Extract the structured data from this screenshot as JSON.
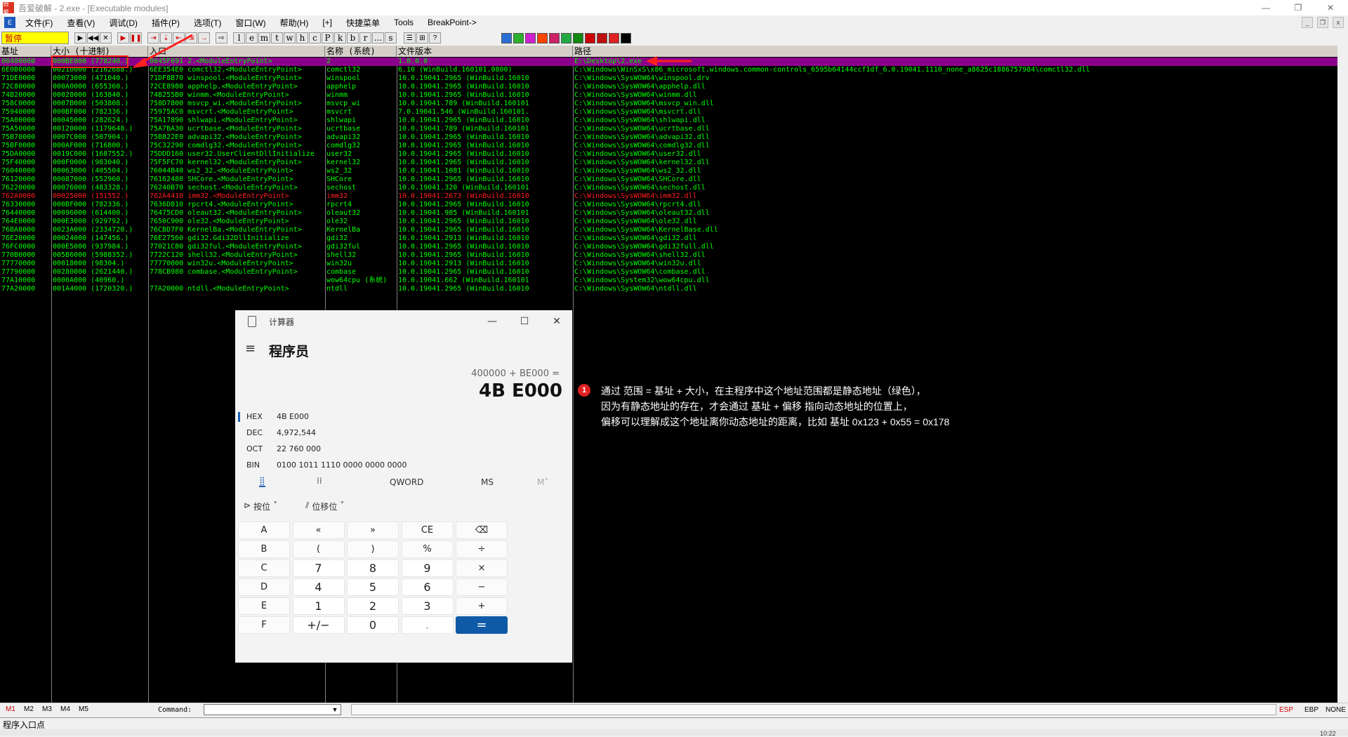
{
  "window": {
    "title": "吾爱破解 - 2.exe - [Executable modules]",
    "icon": "吾爱",
    "minimize": "—",
    "maximize": "❐",
    "close": "✕"
  },
  "menu": {
    "logo": "E",
    "items": [
      "文件(F)",
      "查看(V)",
      "调试(D)",
      "插件(P)",
      "选项(T)",
      "窗口(W)",
      "帮助(H)",
      "[+]",
      "快捷菜单",
      "Tools",
      "BreakPoint->"
    ]
  },
  "mdi": {
    "min": "_",
    "restore": "❐",
    "close": "x"
  },
  "toolbar": {
    "status": "暂停",
    "buttons": [
      "▶",
      "◀◀",
      "✕",
      "▶",
      "❚❚",
      "⇥",
      "⇣",
      "⇤",
      "⇲",
      "→",
      "⇨"
    ],
    "letters": [
      "l",
      "e",
      "m",
      "t",
      "w",
      "h",
      "c",
      "P",
      "k",
      "b",
      "r",
      "...",
      "s"
    ],
    "view_buttons": [
      "☰",
      "⊞",
      "?"
    ],
    "plugin_colors": [
      "#2a6fd6",
      "#2bb02b",
      "#d020d0",
      "#ff4400",
      "#cc2266",
      "#22aa44",
      "#118811",
      "#cc0000",
      "#bb1111",
      "#dd2222",
      "#000000"
    ]
  },
  "columns": {
    "base": "基址",
    "size": "大小   (十进制)",
    "entry": "入口",
    "name": "名称    (系统)",
    "version": "文件版本",
    "path": "路径"
  },
  "modules": [
    {
      "base": "00400000",
      "size": "000BE000 (778240.)",
      "entry": "0045F691 2.<ModuleEntryPoint>",
      "name": "2",
      "version": "1.0.0.0",
      "path": "E:\\Desktop\\2.exe",
      "style": "selected"
    },
    {
      "base": "6E0B0000",
      "size": "00210000 (2162688.)",
      "entry": "6EE354E0 comctl32.<ModuleEntryPoint>",
      "name": "comctl32",
      "version": "6.10 (WinBuild.160101.0800)",
      "path": "C:\\Windows\\WinSxS\\x86_microsoft.windows.common-controls_6595b64144ccf1df_6.0.19041.1110_none_a8625c1886757984\\comctl32.dll",
      "style": "green"
    },
    {
      "base": "71DE0000",
      "size": "00073000 (471040.)",
      "entry": "71DF8B70 winspool.<ModuleEntryPoint>",
      "name": "winspool",
      "version": "10.0.19041.2965 (WinBuild.16010",
      "path": "C:\\Windows\\SysWOW64\\winspool.drv",
      "style": "green"
    },
    {
      "base": "72C80000",
      "size": "000A0000 (655360.)",
      "entry": "72CE8980 apphelp.<ModuleEntryPoint>",
      "name": "apphelp",
      "version": "10.0.19041.2965 (WinBuild.16010",
      "path": "C:\\Windows\\SysWOW64\\apphelp.dll",
      "style": "green"
    },
    {
      "base": "74B20000",
      "size": "00028000 (163840.)",
      "entry": "74B255B0 winmm.<ModuleEntryPoint>",
      "name": "winmm",
      "version": "10.0.19041.2965 (WinBuild.16010",
      "path": "C:\\Windows\\SysWOW64\\winmm.dll",
      "style": "green"
    },
    {
      "base": "758C0000",
      "size": "0007B000 (503808.)",
      "entry": "758D7800 msvcp_wi.<ModuleEntryPoint>",
      "name": "msvcp_wi",
      "version": "10.0.19041.789 (WinBuild.160101",
      "path": "C:\\Windows\\SysWOW64\\msvcp_win.dll",
      "style": "green"
    },
    {
      "base": "75940000",
      "size": "000BF000 (782336.)",
      "entry": "75975AC0 msvcrt.<ModuleEntryPoint>",
      "name": "msvcrt",
      "version": "7.0.19041.546 (WinBuild.160101.",
      "path": "C:\\Windows\\SysWOW64\\msvcrt.dll",
      "style": "green"
    },
    {
      "base": "75A00000",
      "size": "00045000 (282624.)",
      "entry": "75A17890 shlwapi.<ModuleEntryPoint>",
      "name": "shlwapi",
      "version": "10.0.19041.2965 (WinBuild.16010",
      "path": "C:\\Windows\\SysWOW64\\shlwapi.dll",
      "style": "green"
    },
    {
      "base": "75A50000",
      "size": "00120000 (1179648.)",
      "entry": "75A7BA30 ucrtbase.<ModuleEntryPoint>",
      "name": "ucrtbase",
      "version": "10.0.19041.789 (WinBuild.160101",
      "path": "C:\\Windows\\SysWOW64\\ucrtbase.dll",
      "style": "green"
    },
    {
      "base": "75B70000",
      "size": "0007C000 (507904.)",
      "entry": "75B822E0 advapi32.<ModuleEntryPoint>",
      "name": "advapi32",
      "version": "10.0.19041.2965 (WinBuild.16010",
      "path": "C:\\Windows\\SysWOW64\\advapi32.dll",
      "style": "green"
    },
    {
      "base": "75BF0000",
      "size": "000AF000 (716800.)",
      "entry": "75C32290 comdlg32.<ModuleEntryPoint>",
      "name": "comdlg32",
      "version": "10.0.19041.2965 (WinBuild.16010",
      "path": "C:\\Windows\\SysWOW64\\comdlg32.dll",
      "style": "green"
    },
    {
      "base": "75DA0000",
      "size": "0019C000 (1687552.)",
      "entry": "75DDD160 user32.UserClientDllInitialize",
      "name": "user32",
      "version": "10.0.19041.2965 (WinBuild.16010",
      "path": "C:\\Windows\\SysWOW64\\user32.dll",
      "style": "green"
    },
    {
      "base": "75F40000",
      "size": "000F0000 (983040.)",
      "entry": "75F5FC70 kernel32.<ModuleEntryPoint>",
      "name": "kernel32",
      "version": "10.0.19041.2965 (WinBuild.16010",
      "path": "C:\\Windows\\SysWOW64\\kernel32.dll",
      "style": "green"
    },
    {
      "base": "76040000",
      "size": "00063000 (405504.)",
      "entry": "76044B40 ws2_32.<ModuleEntryPoint>",
      "name": "ws2_32",
      "version": "10.0.19041.1081 (WinBuild.16010",
      "path": "C:\\Windows\\SysWOW64\\ws2_32.dll",
      "style": "green"
    },
    {
      "base": "76120000",
      "size": "00087000 (552960.)",
      "entry": "76162480 SHCore.<ModuleEntryPoint>",
      "name": "SHCore",
      "version": "10.0.19041.2965 (WinBuild.16010",
      "path": "C:\\Windows\\SysWOW64\\SHCore.dll",
      "style": "green"
    },
    {
      "base": "76220000",
      "size": "00076000 (483328.)",
      "entry": "76240B70 sechost.<ModuleEntryPoint>",
      "name": "sechost",
      "version": "10.0.19041.320 (WinBuild.160101",
      "path": "C:\\Windows\\SysWOW64\\sechost.dll",
      "style": "green"
    },
    {
      "base": "762A0000",
      "size": "00025000 (151552.)",
      "entry": "762A4410 imm32.<ModuleEntryPoint>",
      "name": "imm32",
      "version": "10.0.19041.2673 (WinBuild.16010",
      "path": "C:\\Windows\\SysWOW64\\imm32.dll",
      "style": "red"
    },
    {
      "base": "76330000",
      "size": "000BF000 (782336.)",
      "entry": "7636D810 rpcrt4.<ModuleEntryPoint>",
      "name": "rpcrt4",
      "version": "10.0.19041.2965 (WinBuild.16010",
      "path": "C:\\Windows\\SysWOW64\\rpcrt4.dll",
      "style": "green"
    },
    {
      "base": "76440000",
      "size": "00096000 (614400.)",
      "entry": "76475CD0 oleaut32.<ModuleEntryPoint>",
      "name": "oleaut32",
      "version": "10.0.19041.985 (WinBuild.160101",
      "path": "C:\\Windows\\SysWOW64\\oleaut32.dll",
      "style": "green"
    },
    {
      "base": "764E0000",
      "size": "000E3000 (929792.)",
      "entry": "7650C900 ole32.<ModuleEntryPoint>",
      "name": "ole32",
      "version": "10.0.19041.2965 (WinBuild.16010",
      "path": "C:\\Windows\\SysWOW64\\ole32.dll",
      "style": "green"
    },
    {
      "base": "76BA0000",
      "size": "0023A000 (2334720.)",
      "entry": "76CBD7F0 KernelBa.<ModuleEntryPoint>",
      "name": "KernelBa",
      "version": "10.0.19041.2965 (WinBuild.16010",
      "path": "C:\\Windows\\SysWOW64\\KernelBase.dll",
      "style": "green"
    },
    {
      "base": "76E20000",
      "size": "00024000 (147456.)",
      "entry": "76E27560 gdi32.Gdi32DllInitialize",
      "name": "gdi32",
      "version": "10.0.19041.2913 (WinBuild.16010",
      "path": "C:\\Windows\\SysWOW64\\gdi32.dll",
      "style": "green"
    },
    {
      "base": "76FC0000",
      "size": "000E5000 (937984.)",
      "entry": "77021C80 gdi32ful.<ModuleEntryPoint>",
      "name": "gdi32ful",
      "version": "10.0.19041.2965 (WinBuild.16010",
      "path": "C:\\Windows\\SysWOW64\\gdi32full.dll",
      "style": "green"
    },
    {
      "base": "770B0000",
      "size": "005B6000 (5988352.)",
      "entry": "7722C120 shell32.<ModuleEntryPoint>",
      "name": "shell32",
      "version": "10.0.19041.2965 (WinBuild.16010",
      "path": "C:\\Windows\\SysWOW64\\shell32.dll",
      "style": "green"
    },
    {
      "base": "77770000",
      "size": "00018000 (98304.)",
      "entry": "77770000 win32u.<ModuleEntryPoint>",
      "name": "win32u",
      "version": "10.0.19041.2913 (WinBuild.16010",
      "path": "C:\\Windows\\SysWOW64\\win32u.dll",
      "style": "green"
    },
    {
      "base": "77790000",
      "size": "00280000 (2621440.)",
      "entry": "778CB980 combase.<ModuleEntryPoint>",
      "name": "combase",
      "version": "10.0.19041.2965 (WinBuild.16010",
      "path": "C:\\Windows\\SysWOW64\\combase.dll",
      "style": "green"
    },
    {
      "base": "77A10000",
      "size": "0000A000 (40960.)",
      "entry": "",
      "name": "wow64cpu (系统)",
      "version": "10.0.19041.662 (WinBuild.160101",
      "path": "C:\\Windows\\System32\\wow64cpu.dll",
      "style": "green"
    },
    {
      "base": "77A20000",
      "size": "001A4000 (1720320.)",
      "entry": "77A20000 ntdll.<ModuleEntryPoint>",
      "name": "ntdll",
      "version": "10.0.19041.2965 (WinBuild.16010",
      "path": "C:\\Windows\\SysWOW64\\ntdll.dll",
      "style": "green"
    }
  ],
  "calculator": {
    "title": "计算器",
    "menu_icon": "≡",
    "mode": "程序员",
    "min": "—",
    "max": "☐",
    "close": "✕",
    "expression": "400000 + BE000 =",
    "result": "4B E000",
    "radix": [
      {
        "label": "HEX",
        "value": "4B E000"
      },
      {
        "label": "DEC",
        "value": "4,972,544"
      },
      {
        "label": "OCT",
        "value": "22 760 000"
      },
      {
        "label": "BIN",
        "value": "0100 1011 1110 0000 0000 0000"
      }
    ],
    "mode_row": {
      "keypad": "⣿",
      "bit": "⁞⁞",
      "word": "QWORD",
      "ms": "MS",
      "mview": "M˅"
    },
    "bitwise": "按位",
    "bitshift": "位移位",
    "bitwise_icon": "⊳",
    "bitshift_icon": "⫽",
    "chev": "˅",
    "keys": [
      [
        "A",
        "«",
        "»",
        "CE",
        "⌫"
      ],
      [
        "B",
        "(",
        ")",
        "%",
        "÷"
      ],
      [
        "C",
        "7",
        "8",
        "9",
        "×"
      ],
      [
        "D",
        "4",
        "5",
        "6",
        "−"
      ],
      [
        "E",
        "1",
        "2",
        "3",
        "+"
      ],
      [
        "F",
        "+/−",
        "0",
        ".",
        "="
      ]
    ]
  },
  "annotation": {
    "badge": "1",
    "lines": [
      "通过 范围 = 基址 + 大小，在主程序中这个地址范围都是静态地址（绿色），",
      "因为有静态地址的存在，才会通过 基址 + 偏移 指向动态地址的位置上，",
      "偏移可以理解成这个地址离你动态地址的距离，比如 基址 0x123 + 0x55 = 0x178"
    ]
  },
  "bottom": {
    "tabs": [
      "M1",
      "M2",
      "M3",
      "M4",
      "M5"
    ],
    "command_label": "Command:",
    "dropdown": "▼",
    "registers": [
      "ESP",
      "EBP",
      "NONE"
    ]
  },
  "status": {
    "text": "程序入口点",
    "clock": "10:22"
  }
}
